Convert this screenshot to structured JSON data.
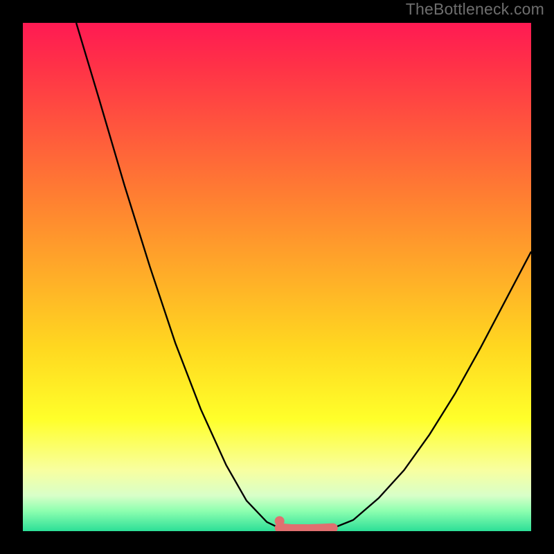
{
  "watermark": "TheBottleneck.com",
  "chart_data": {
    "type": "line",
    "title": "",
    "xlabel": "",
    "ylabel": "",
    "xlim": [
      0,
      100
    ],
    "ylim": [
      0,
      100
    ],
    "series": [
      {
        "name": "left-curve",
        "x": [
          10.5,
          15,
          20,
          25,
          30,
          35,
          40,
          44,
          48,
          50.5
        ],
        "y": [
          100,
          85,
          68,
          52,
          37,
          24,
          13,
          6,
          1.8,
          0.6
        ]
      },
      {
        "name": "right-curve",
        "x": [
          61,
          65,
          70,
          75,
          80,
          85,
          90,
          95,
          100
        ],
        "y": [
          0.6,
          2.2,
          6.5,
          12,
          19,
          27,
          36,
          45.5,
          55
        ]
      },
      {
        "name": "floor-segment",
        "x": [
          50.5,
          53,
          56,
          59,
          61
        ],
        "y": [
          0.6,
          0.4,
          0.4,
          0.5,
          0.6
        ],
        "style": "thick-pink"
      },
      {
        "name": "left-dot",
        "x": [
          50.5
        ],
        "y": [
          2.0
        ],
        "style": "dot-pink"
      }
    ],
    "colors": {
      "curve": "#000000",
      "highlight": "#e07070",
      "background_top": "#ff1a53",
      "background_bottom": "#2cdf97"
    }
  }
}
